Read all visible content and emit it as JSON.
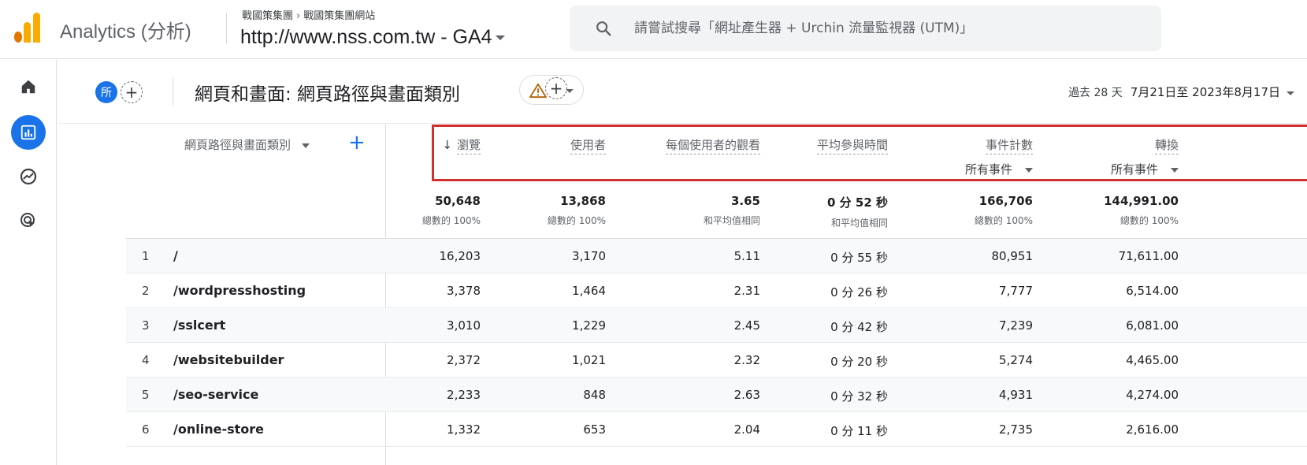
{
  "app": {
    "name": "Analytics (分析)"
  },
  "breadcrumb": {
    "account": "戰國策集團",
    "property_group": "戰國策集團網站"
  },
  "property": {
    "name": "http://www.nss.com.tw - GA4"
  },
  "search": {
    "placeholder": "請嘗試搜尋「網址產生器 + Urchin 流量監視器 (UTM)」"
  },
  "rail": {
    "items": [
      "home-icon",
      "reports-icon",
      "explore-icon",
      "advertising-icon"
    ],
    "active": "reports-icon"
  },
  "report": {
    "segment_chip": "所",
    "title": "網頁和畫面: 網頁路徑與畫面類別",
    "date_prefix": "過去 28 天",
    "date_range": "7月21日至 2023年8月17日"
  },
  "table": {
    "dimension_header": "網頁路徑與畫面類別",
    "columns": [
      {
        "label": "瀏覽",
        "sorted": true,
        "sub": ""
      },
      {
        "label": "使用者",
        "sub": ""
      },
      {
        "label": "每個使用者的觀看",
        "sub": ""
      },
      {
        "label": "平均參與時間",
        "sub": ""
      },
      {
        "label": "事件計數",
        "sub": "所有事件"
      },
      {
        "label": "轉換",
        "sub": "所有事件"
      }
    ],
    "totals": [
      {
        "value": "50,648",
        "note": "總數的 100%"
      },
      {
        "value": "13,868",
        "note": "總數的 100%"
      },
      {
        "value": "3.65",
        "note": "和平均值相同"
      },
      {
        "value": "0 分 52 秒",
        "note": "和平均值相同"
      },
      {
        "value": "166,706",
        "note": "總數的 100%"
      },
      {
        "value": "144,991.00",
        "note": "總數的 100%"
      }
    ],
    "rows": [
      {
        "idx": "1",
        "path": "/",
        "cells": [
          "16,203",
          "3,170",
          "5.11",
          "0 分 55 秒",
          "80,951",
          "71,611.00"
        ]
      },
      {
        "idx": "2",
        "path": "/wordpresshosting",
        "cells": [
          "3,378",
          "1,464",
          "2.31",
          "0 分 26 秒",
          "7,777",
          "6,514.00"
        ]
      },
      {
        "idx": "3",
        "path": "/sslcert",
        "cells": [
          "3,010",
          "1,229",
          "2.45",
          "0 分 42 秒",
          "7,239",
          "6,081.00"
        ]
      },
      {
        "idx": "4",
        "path": "/websitebuilder",
        "cells": [
          "2,372",
          "1,021",
          "2.32",
          "0 分 20 秒",
          "5,274",
          "4,465.00"
        ]
      },
      {
        "idx": "5",
        "path": "/seo-service",
        "cells": [
          "2,233",
          "848",
          "2.63",
          "0 分 32 秒",
          "4,931",
          "4,274.00"
        ]
      },
      {
        "idx": "6",
        "path": "/online-store",
        "cells": [
          "1,332",
          "653",
          "2.04",
          "0 分 11 秒",
          "2,735",
          "2,616.00"
        ]
      }
    ]
  },
  "colors": {
    "accent": "#1a73e8",
    "highlight_box": "#d32f2f",
    "logo_orange": "#e37400",
    "logo_yellow": "#f9ab00",
    "warning": "#b06000"
  }
}
